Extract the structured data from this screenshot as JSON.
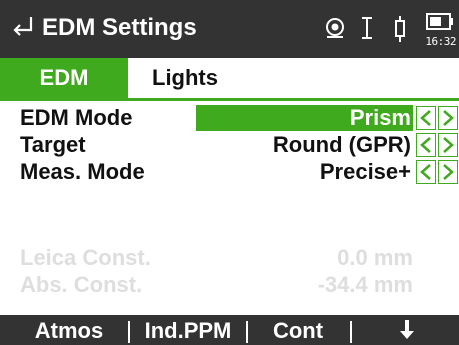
{
  "titlebar": {
    "title": "EDM Settings",
    "time": "16:32",
    "icons": [
      "back-arrow-icon",
      "prism-target-icon",
      "measure-cursor-icon",
      "laser-pointer-icon",
      "battery-icon"
    ]
  },
  "tabs": [
    {
      "label": "EDM",
      "active": true
    },
    {
      "label": "Lights",
      "active": false
    }
  ],
  "rows": [
    {
      "label": "EDM Mode",
      "value": "Prism",
      "selected": true
    },
    {
      "label": "Target",
      "value": "Round (GPR)",
      "selected": false
    },
    {
      "label": "Meas. Mode",
      "value": "Precise+",
      "selected": false
    }
  ],
  "constants": [
    {
      "label": "Leica Const.",
      "value": "0.0 mm"
    },
    {
      "label": "Abs. Const.",
      "value": "-34.4 mm"
    }
  ],
  "softkeys": {
    "k1": "Atmos",
    "k2": "Ind.PPM",
    "k3": "Cont",
    "k4_icon": "scroll-down-arrow-icon"
  },
  "colors": {
    "accent": "#3faa1e",
    "bar": "#333333",
    "disabled": "#dedede"
  }
}
